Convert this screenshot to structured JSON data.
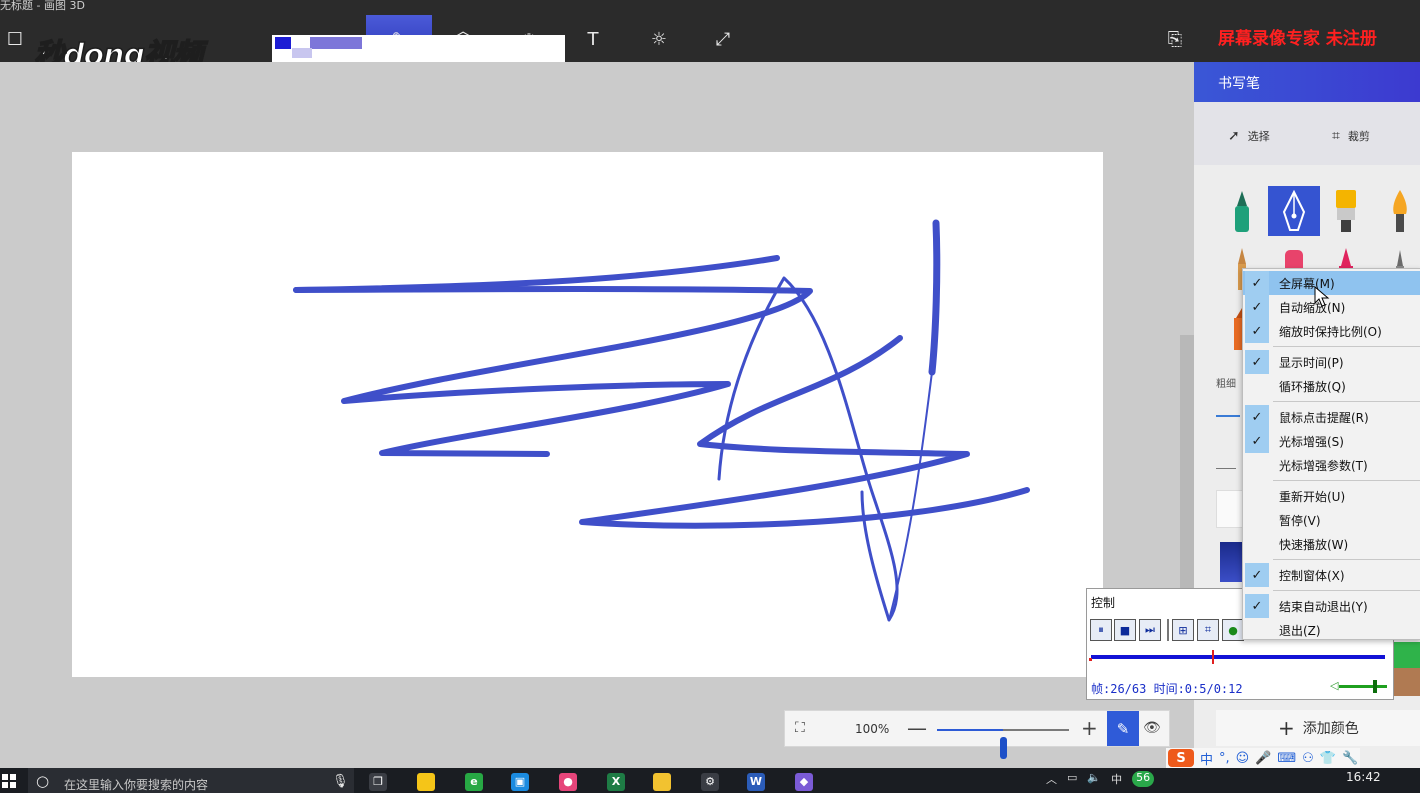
{
  "app": {
    "title": "无标题 - 画图 3D",
    "watermark": "秒dong视频",
    "recorder_watermark": "屏幕录像专家 未注册"
  },
  "toolbar": {
    "icons": [
      "folder-icon",
      "brush-icon",
      "shapes-3d-icon",
      "stickers-icon",
      "text-icon",
      "effects-icon",
      "canvas-icon",
      "paste-icon",
      "redo-icon",
      "history-icon"
    ],
    "text_tool_glyph": "T"
  },
  "panel": {
    "title": "书写笔",
    "select_label": "选择",
    "crop_label": "裁剪",
    "thickness_label": "粗细",
    "add_color_label": "添加颜色",
    "tools": [
      {
        "name": "marker",
        "color": "#1ea07a",
        "selected": false
      },
      {
        "name": "calligraphy-pen",
        "color": "#ffffff",
        "selected": true
      },
      {
        "name": "oil-brush",
        "color": "#f4b400",
        "selected": false
      },
      {
        "name": "watercolor",
        "color": "#f5a623",
        "selected": false
      },
      {
        "name": "pencil",
        "color": "#c68642",
        "selected": false
      },
      {
        "name": "eraser",
        "color": "#e8436b",
        "selected": false
      },
      {
        "name": "crayon",
        "color": "#e0245e",
        "selected": false
      },
      {
        "name": "pixel-pen",
        "color": "#6b6b6b",
        "selected": false
      }
    ],
    "accent_color": "#3554d1"
  },
  "canvas": {
    "stroke_color": "#3f4fc9"
  },
  "zoom": {
    "value_label": "100%",
    "slider_level": 0.5,
    "minus": "—",
    "plus": "+"
  },
  "control": {
    "title": "控制",
    "frame_text": "帧:26/63 时间:0:5/0:12",
    "progress_fraction": 0.4127,
    "volume_level": 0.7
  },
  "context_menu": {
    "items": [
      {
        "label": "全屏幕(M)",
        "checked": true,
        "highlighted": true
      },
      {
        "label": "自动缩放(N)",
        "checked": true,
        "highlighted": false
      },
      {
        "label": "缩放时保持比例(O)",
        "checked": true,
        "highlighted": false
      },
      {
        "separator": true
      },
      {
        "label": "显示时间(P)",
        "checked": true,
        "highlighted": false
      },
      {
        "label": "循环播放(Q)",
        "checked": false,
        "highlighted": false
      },
      {
        "separator": true
      },
      {
        "label": "鼠标点击提醒(R)",
        "checked": true,
        "highlighted": false
      },
      {
        "label": "光标增强(S)",
        "checked": true,
        "highlighted": false
      },
      {
        "label": "光标增强参数(T)",
        "checked": false,
        "highlighted": false
      },
      {
        "separator": true
      },
      {
        "label": "重新开始(U)",
        "checked": false,
        "highlighted": false
      },
      {
        "label": "暂停(V)",
        "checked": false,
        "highlighted": false
      },
      {
        "label": "快速播放(W)",
        "checked": false,
        "highlighted": false
      },
      {
        "separator": true
      },
      {
        "label": "控制窗体(X)",
        "checked": true,
        "highlighted": false
      },
      {
        "separator": true
      },
      {
        "label": "结束自动退出(Y)",
        "checked": true,
        "highlighted": false
      },
      {
        "label": "退出(Z)",
        "checked": false,
        "highlighted": false
      }
    ]
  },
  "ime": {
    "logo": "S",
    "lang": "中",
    "icons": [
      "punctuation-icon",
      "emoji-icon",
      "voice-icon",
      "keyboard-icon",
      "toolbox-icon",
      "skin-icon",
      "settings-icon"
    ]
  },
  "taskbar": {
    "search_placeholder": "在这里输入你要搜索的内容",
    "apps": [
      {
        "name": "task-view",
        "color": "#3a3d44",
        "glyph": "❐"
      },
      {
        "name": "sticky-notes",
        "color": "#f5c518",
        "glyph": ""
      },
      {
        "name": "360-browser",
        "color": "#27a844",
        "glyph": "e"
      },
      {
        "name": "store",
        "color": "#1b8be0",
        "glyph": "▣"
      },
      {
        "name": "tag-app",
        "color": "#e6457a",
        "glyph": "●"
      },
      {
        "name": "excel",
        "color": "#1e7c45",
        "glyph": "X"
      },
      {
        "name": "file-explorer",
        "color": "#f2c230",
        "glyph": ""
      },
      {
        "name": "settings",
        "color": "#3a3d44",
        "glyph": "⚙"
      },
      {
        "name": "word",
        "color": "#2b5cb8",
        "glyph": "W"
      },
      {
        "name": "paint-3d",
        "color": "#7b5bd6",
        "glyph": "◆"
      }
    ],
    "tray_lang": "中",
    "tray_badge": "56",
    "time": "16:42"
  }
}
